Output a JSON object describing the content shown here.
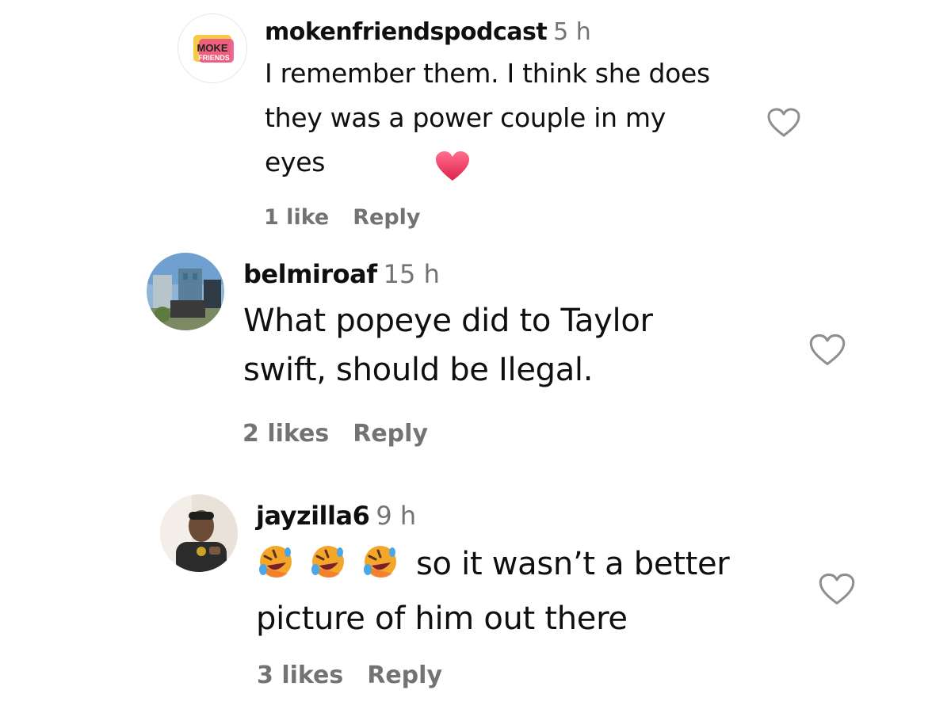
{
  "comments": [
    {
      "username": "mokenfriendspodcast",
      "time": "5 h",
      "text": "I remember them. I think she does they was a power couple in my eyes",
      "likes": "1 like",
      "reply": "Reply",
      "avatar_text": "MOKE FRIENDS"
    },
    {
      "username": "belmiroaf",
      "time": "15 h",
      "text_line1": "What popeye did to Taylor",
      "text_line2": "swift, should be Ilegal.",
      "likes": "2 likes",
      "reply": "Reply"
    },
    {
      "username": "jayzilla6",
      "time": "9 h",
      "text_line1": "so it wasn’t a better",
      "text_line2": "picture of him out there",
      "likes": "3 likes",
      "reply": "Reply"
    }
  ],
  "colors": {
    "text": "#0f0f0f",
    "secondary": "#737373",
    "heart_emoji": "#ef3c63"
  },
  "icons": {
    "like": "heart-outline-icon",
    "emoji_laugh": "rolling-on-the-floor-laughing-emoji",
    "emoji_heart": "red-heart-emoji"
  }
}
